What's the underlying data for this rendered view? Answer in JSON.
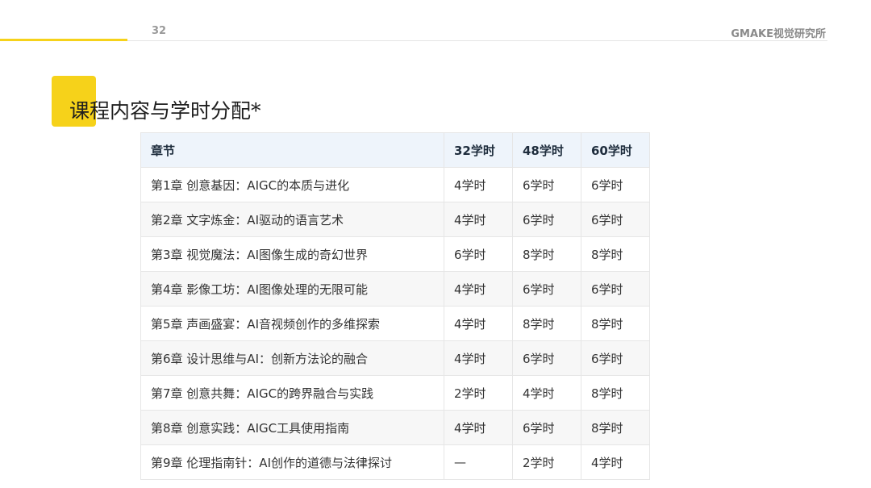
{
  "header": {
    "page_number": "32",
    "brand": "GMAKE视觉研究所",
    "accent_color": "#f6d21a"
  },
  "title": "课程内容与学时分配*",
  "table": {
    "columns": [
      "章节",
      "32学时",
      "48学时",
      "60学时"
    ],
    "rows": [
      [
        "第1章 创意基因：AIGC的本质与进化",
        "4学时",
        "6学时",
        "6学时"
      ],
      [
        "第2章 文字炼金：AI驱动的语言艺术",
        "4学时",
        "6学时",
        "6学时"
      ],
      [
        "第3章 视觉魔法：AI图像生成的奇幻世界",
        "6学时",
        "8学时",
        "8学时"
      ],
      [
        "第4章 影像工坊：AI图像处理的无限可能",
        "4学时",
        "6学时",
        "6学时"
      ],
      [
        "第5章 声画盛宴：AI音视频创作的多维探索",
        "4学时",
        "8学时",
        "8学时"
      ],
      [
        "第6章 设计思维与AI：创新方法论的融合",
        "4学时",
        "6学时",
        "6学时"
      ],
      [
        "第7章 创意共舞：AIGC的跨界融合与实践",
        "2学时",
        "4学时",
        "8学时"
      ],
      [
        "第8章 创意实践：AIGC工具使用指南",
        "4学时",
        "6学时",
        "8学时"
      ],
      [
        "第9章 伦理指南针：AI创作的道德与法律探讨",
        "—",
        "2学时",
        "4学时"
      ]
    ]
  }
}
